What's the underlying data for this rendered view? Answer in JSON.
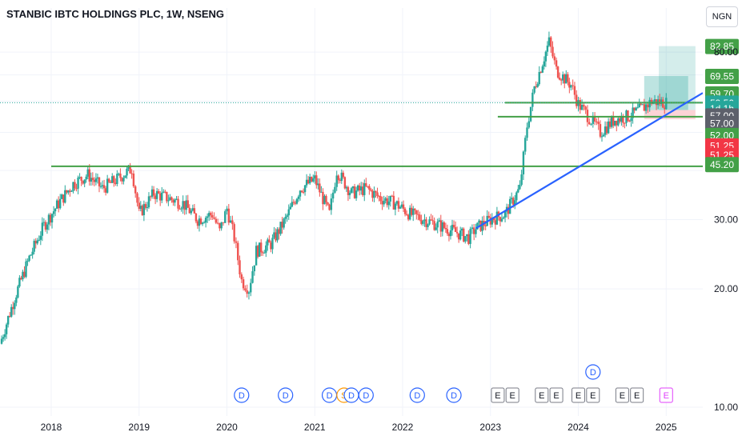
{
  "header": {
    "title": "STANBIC IBTC HOLDINGS PLC, 1W, NSENG",
    "currency": "NGN"
  },
  "colors": {
    "up": "#26a69a",
    "down": "#ef5350",
    "trendline": "#2962ff",
    "level": "#43a047",
    "green_badge": "#43a047",
    "red_badge": "#f23645",
    "gray_badge": "#5d606b",
    "teal_badge": "#26a69a",
    "earnings": "#787b86",
    "dividend": "#2962ff",
    "split": "#ff9800",
    "earnings_upcoming": "#e040fb"
  },
  "chart_data": {
    "type": "candlestick",
    "title": "STANBIC IBTC HOLDINGS PLC, 1W, NSENG",
    "y_scale": "log",
    "ylim": [
      9.5,
      90
    ],
    "xlim": [
      "2017-06",
      "2025-06"
    ],
    "y_ticks": [
      10,
      20,
      30,
      40,
      50,
      60,
      70,
      80
    ],
    "y_tick_labels": [
      "10.00",
      "20.00",
      "30.00",
      "",
      "",
      "",
      "",
      "80.00"
    ],
    "x_ticks": [
      "2018",
      "2019",
      "2020",
      "2021",
      "2022",
      "2023",
      "2024",
      "2025"
    ],
    "grid": true,
    "approx_close_path": [
      [
        "2017-06",
        14.5
      ],
      [
        "2017-08",
        19
      ],
      [
        "2017-10",
        24
      ],
      [
        "2017-12",
        29
      ],
      [
        "2018-02",
        33
      ],
      [
        "2018-04",
        37
      ],
      [
        "2018-06",
        39
      ],
      [
        "2018-08",
        36
      ],
      [
        "2018-10",
        38
      ],
      [
        "2018-12",
        40.5
      ],
      [
        "2019-01",
        31
      ],
      [
        "2019-03",
        35
      ],
      [
        "2019-05",
        34
      ],
      [
        "2019-07",
        33
      ],
      [
        "2019-09",
        30
      ],
      [
        "2019-11",
        31
      ],
      [
        "2019-12",
        28
      ],
      [
        "2020-01",
        32
      ],
      [
        "2020-02",
        27
      ],
      [
        "2020-03",
        21
      ],
      [
        "2020-04",
        20
      ],
      [
        "2020-05",
        25
      ],
      [
        "2020-07",
        26
      ],
      [
        "2020-09",
        30
      ],
      [
        "2020-11",
        36
      ],
      [
        "2021-01",
        38
      ],
      [
        "2021-03",
        31
      ],
      [
        "2021-04",
        40
      ],
      [
        "2021-06",
        35
      ],
      [
        "2021-08",
        36
      ],
      [
        "2021-10",
        34
      ],
      [
        "2021-12",
        33
      ],
      [
        "2022-02",
        31
      ],
      [
        "2022-04",
        30
      ],
      [
        "2022-06",
        29
      ],
      [
        "2022-08",
        28
      ],
      [
        "2022-10",
        27
      ],
      [
        "2022-11",
        28.5
      ],
      [
        "2023-01",
        30
      ],
      [
        "2023-03",
        31
      ],
      [
        "2023-05",
        36
      ],
      [
        "2023-06",
        52
      ],
      [
        "2023-07",
        65
      ],
      [
        "2023-09",
        85
      ],
      [
        "2023-10",
        72
      ],
      [
        "2023-12",
        66
      ],
      [
        "2024-01",
        59
      ],
      [
        "2024-02",
        56
      ],
      [
        "2024-03",
        53
      ],
      [
        "2024-04",
        50
      ],
      [
        "2024-06",
        54
      ],
      [
        "2024-08",
        55
      ],
      [
        "2024-10",
        58
      ],
      [
        "2024-11",
        60
      ],
      [
        "2025-01",
        59.5
      ]
    ],
    "horizontal_levels": [
      {
        "name": "resistance-level",
        "value": 59.5,
        "from": "2023-03",
        "to": "2025-06"
      },
      {
        "name": "mid-level",
        "value": 54.8,
        "from": "2023-02",
        "to": "2025-06"
      },
      {
        "name": "support-level",
        "value": 41.0,
        "from": "2018-01",
        "to": "2025-06"
      }
    ],
    "trendline": {
      "from": [
        "2022-11",
        28.5
      ],
      "to": [
        "2025-06",
        63
      ]
    },
    "position_tool": {
      "profit_zone_outer": {
        "from": "2024-12",
        "to": "2025-05",
        "top": 82.85,
        "bottom": 57
      },
      "profit_zone_inner": {
        "from": "2024-10",
        "to": "2025-04",
        "top": 69.55,
        "bottom": 57
      },
      "stop_zone": {
        "from": "2024-10",
        "to": "2025-05",
        "top": 57,
        "bottom": 54
      }
    },
    "price_badges": [
      {
        "label": "82.85",
        "value": 82.85,
        "style": "green"
      },
      {
        "label": "80.00",
        "value": 80.0,
        "style": "tick"
      },
      {
        "label": "69.55",
        "value": 69.55,
        "style": "green"
      },
      {
        "label": "59.70",
        "value": 62.8,
        "style": "green"
      },
      {
        "label": "59.50",
        "value": 59.5,
        "style": "teal"
      },
      {
        "label": "1d 1h",
        "value": 57.6,
        "style": "teal"
      },
      {
        "label": "57.00",
        "value": 55.2,
        "style": "gray"
      },
      {
        "label": "57.00",
        "value": 52.8,
        "style": "gray"
      },
      {
        "label": "52.00",
        "value": 49.2,
        "style": "green"
      },
      {
        "label": "51.25",
        "value": 46.3,
        "style": "red"
      },
      {
        "label": "51.25",
        "value": 43.8,
        "style": "red"
      },
      {
        "label": "45.20",
        "value": 41.5,
        "style": "green"
      }
    ],
    "events": [
      {
        "type": "D",
        "date": "2020-03"
      },
      {
        "type": "D",
        "date": "2020-09"
      },
      {
        "type": "D",
        "date": "2021-03"
      },
      {
        "type": "S",
        "date": "2021-05"
      },
      {
        "type": "D",
        "date": "2021-06"
      },
      {
        "type": "D",
        "date": "2021-08"
      },
      {
        "type": "D",
        "date": "2022-03"
      },
      {
        "type": "D",
        "date": "2022-08"
      },
      {
        "type": "E",
        "date": "2023-02"
      },
      {
        "type": "E",
        "date": "2023-04"
      },
      {
        "type": "E",
        "date": "2023-08"
      },
      {
        "type": "E",
        "date": "2023-10"
      },
      {
        "type": "E",
        "date": "2024-01"
      },
      {
        "type": "E",
        "date": "2024-03"
      },
      {
        "type": "D",
        "date": "2024-03",
        "raised": true
      },
      {
        "type": "E",
        "date": "2024-07"
      },
      {
        "type": "E",
        "date": "2024-09"
      },
      {
        "type": "E",
        "date": "2025-01",
        "upcoming": true
      }
    ]
  }
}
